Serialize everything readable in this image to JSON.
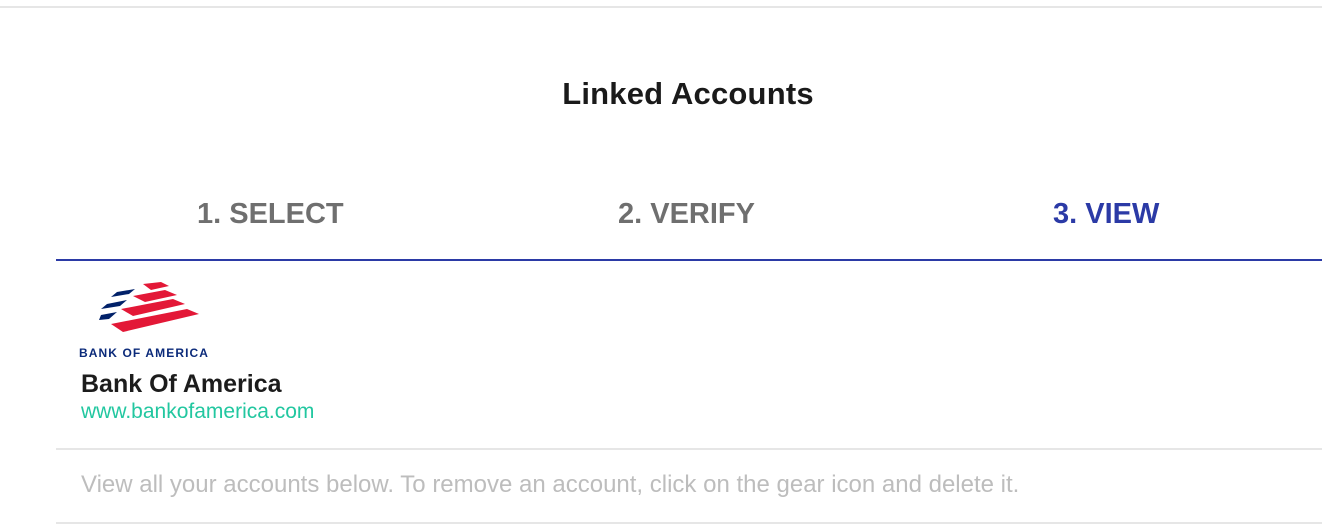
{
  "header": {
    "title": "Linked Accounts"
  },
  "steps": [
    {
      "label": "1. SELECT",
      "active": false
    },
    {
      "label": "2. VERIFY",
      "active": false
    },
    {
      "label": "3. VIEW",
      "active": true
    }
  ],
  "bank": {
    "logo_text": "BANK OF AMERICA",
    "name": "Bank Of America",
    "url": "www.bankofamerica.com"
  },
  "helper": {
    "text": "View all your accounts below. To remove an account, click on the gear icon and delete it."
  },
  "colors": {
    "active_step": "#2b3aa6",
    "inactive_step": "#6f6f6f",
    "link": "#22c7a0",
    "logo_red": "#e31837",
    "logo_navy": "#012169",
    "divider": "#e6e6e6"
  }
}
